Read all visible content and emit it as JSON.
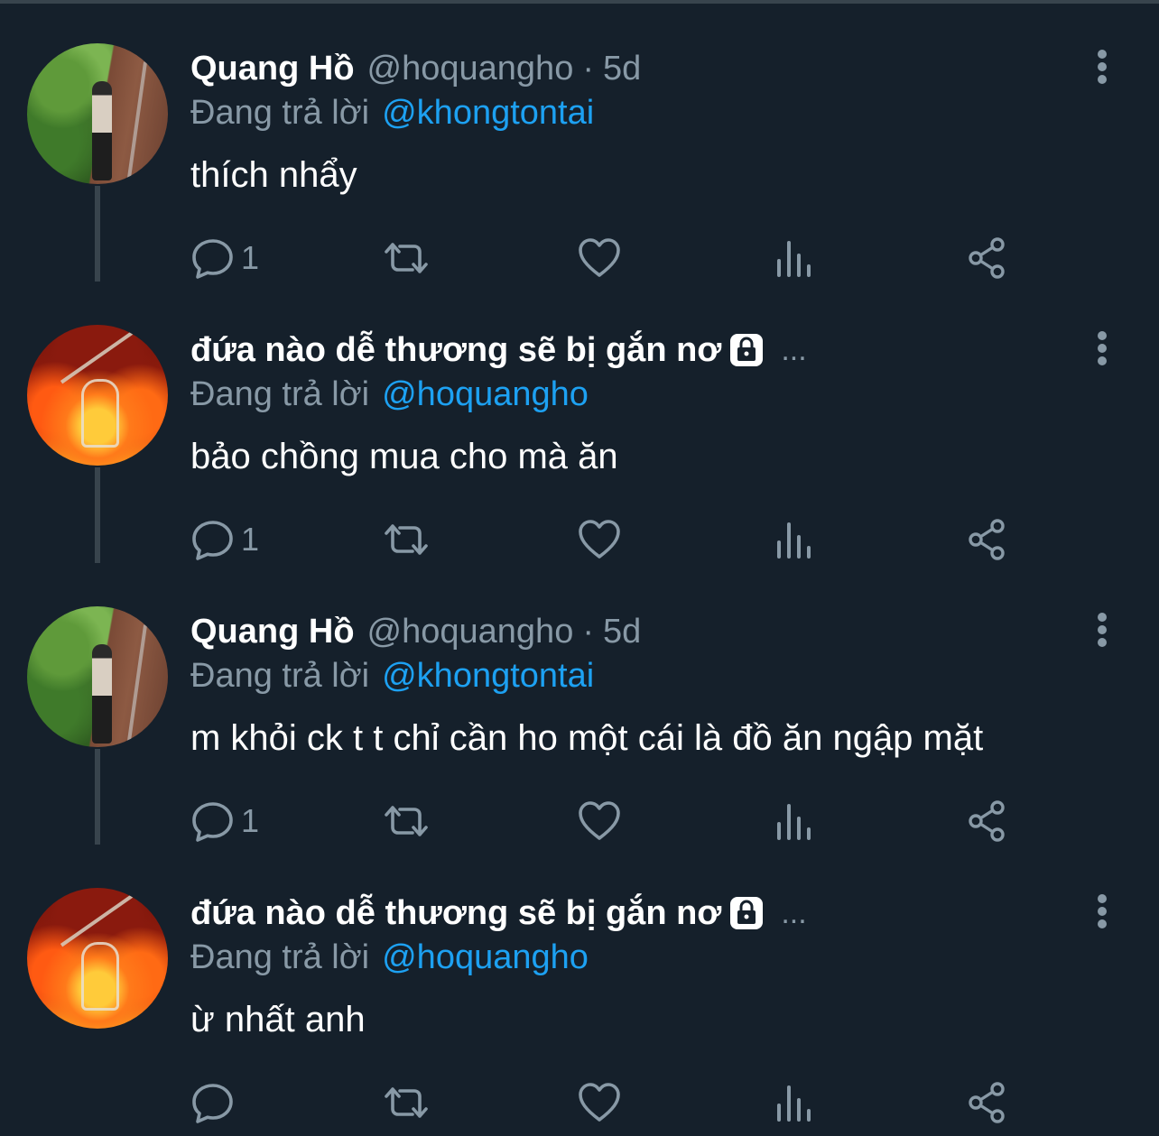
{
  "colors": {
    "background": "#15202b",
    "muted": "#8899a6",
    "link": "#1da1f2",
    "connector": "#38444d"
  },
  "tweets": [
    {
      "author_name": "Quang Hồ",
      "author_handle": "@hoquangho",
      "separator": "·",
      "time": "5d",
      "replying_label": "Đang trả lời",
      "replying_to": "@khongtontai",
      "text": "thích nhẩy",
      "reply_count": "1",
      "avatar": "photo"
    },
    {
      "author_name": "đứa nào dễ thương sẽ bị gắn nơ",
      "author_handle": "",
      "time": "",
      "ellipsis": "...",
      "protected_icon": "lock-icon",
      "replying_label": "Đang trả lời",
      "replying_to": "@hoquangho",
      "text": "bảo chồng mua cho mà ăn",
      "reply_count": "1",
      "avatar": "fire"
    },
    {
      "author_name": "Quang Hồ",
      "author_handle": "@hoquangho",
      "separator": "·",
      "time": "5d",
      "replying_label": "Đang trả lời",
      "replying_to": "@khongtontai",
      "text": "m khỏi ck t t chỉ cần ho một cái là đồ ăn ngập mặt",
      "reply_count": "1",
      "avatar": "photo"
    },
    {
      "author_name": "đứa nào dễ thương sẽ bị gắn nơ",
      "author_handle": "",
      "time": "",
      "ellipsis": "...",
      "protected_icon": "lock-icon",
      "replying_label": "Đang trả lời",
      "replying_to": "@hoquangho",
      "text": "ừ nhất anh",
      "reply_count": "",
      "avatar": "fire"
    }
  ],
  "action_icons": [
    "reply-icon",
    "retweet-icon",
    "like-icon",
    "stats-icon",
    "share-icon"
  ]
}
